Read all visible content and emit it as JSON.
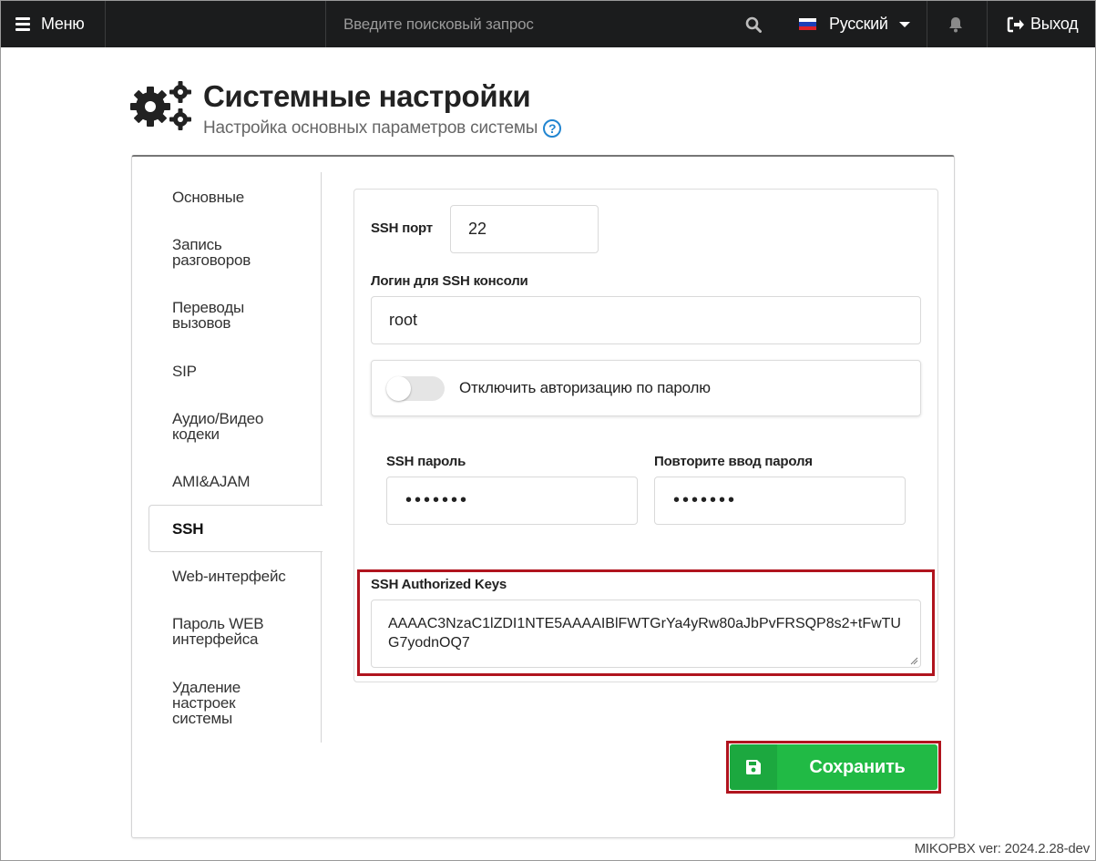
{
  "topbar": {
    "menu_label": "Меню",
    "search_placeholder": "Введите поисковый запрос",
    "language": "Русский",
    "logout_label": "Выход"
  },
  "header": {
    "title": "Системные настройки",
    "subtitle": "Настройка основных параметров системы",
    "help_glyph": "?"
  },
  "sidebar": {
    "items": [
      {
        "label": "Основные"
      },
      {
        "label": "Запись разговоров"
      },
      {
        "label": "Переводы вызовов"
      },
      {
        "label": "SIP"
      },
      {
        "label": "Аудио/Видео кодеки"
      },
      {
        "label": "AMI&AJAM"
      },
      {
        "label": "SSH",
        "active": true
      },
      {
        "label": "Web-интерфейс"
      },
      {
        "label": "Пароль WEB интерфейса"
      },
      {
        "label": "Удаление настроек системы"
      }
    ]
  },
  "form": {
    "ssh_port_label": "SSH порт",
    "ssh_port_value": "22",
    "ssh_login_label": "Логин для SSH консоли",
    "ssh_login_value": "root",
    "disable_password_auth_label": "Отключить авторизацию по паролю",
    "disable_password_auth_checked": false,
    "ssh_password_label": "SSH пароль",
    "ssh_password_value": "•••••••",
    "ssh_password_repeat_label": "Повторите ввод пароля",
    "ssh_password_repeat_value": "•••••••",
    "authorized_keys_label": "SSH Authorized Keys",
    "authorized_keys_value": "AAAAC3NzaC1lZDI1NTE5AAAAIBlFWTGrYa4yRw80aJbPvFRSQP8s2+tFwTUG7yodnOQ7"
  },
  "actions": {
    "save_label": "Сохранить"
  },
  "footer": {
    "version": "MIKOPBX ver: 2024.2.28-dev"
  },
  "colors": {
    "topbar_bg": "#1b1c1d",
    "save_green": "#21ba45",
    "highlight_red": "#b0141e",
    "help_blue": "#2185d0"
  }
}
